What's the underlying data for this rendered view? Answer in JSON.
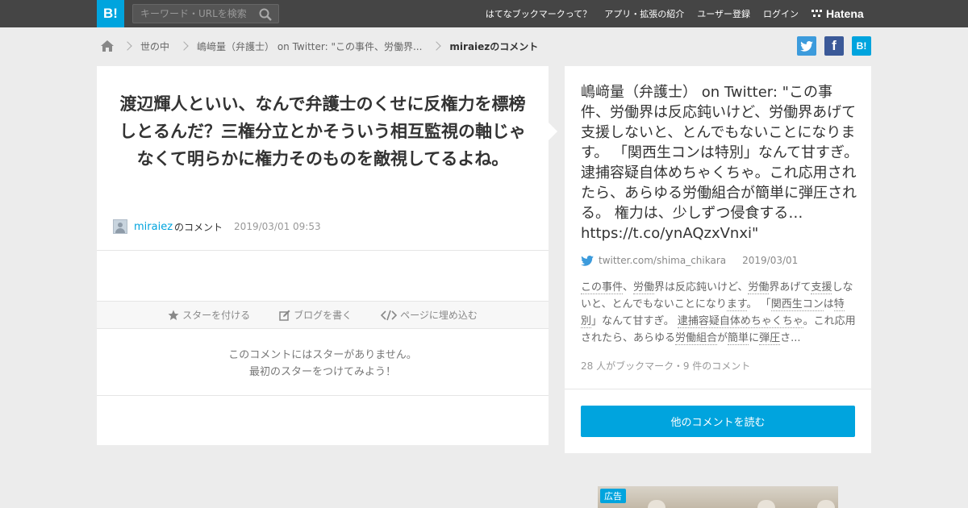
{
  "header": {
    "logo_text": "B!",
    "search_placeholder": "キーワード・URLを検索",
    "nav": [
      "はてなブックマークって？",
      "アプリ・拡張の紹介",
      "ユーザー登録",
      "ログイン"
    ],
    "hatena_label": "Hatena"
  },
  "breadcrumb": {
    "category": "世の中",
    "entry": "嶋﨑量（弁護士） on Twitter: \"この事件、労働界...",
    "current": "miraiezのコメント"
  },
  "share": {
    "hatena_label": "B!",
    "facebook_label": "f",
    "colors": {
      "twitter": "#3c9bdc",
      "facebook": "#3b5998",
      "hatena": "#00a4de"
    }
  },
  "comment": {
    "text": "渡辺輝人といい、なんで弁護士のくせに反権力を標榜しとるんだ？三権分立とかそういう相互監視の軸じゃなくて明らかに権力そのものを敵視してるよね。",
    "user": "miraiez",
    "user_suffix": "のコメント",
    "date": "2019/03/01 09:53"
  },
  "actions": {
    "star": "スターを付ける",
    "blog": "ブログを書く",
    "embed": "ページに埋め込む"
  },
  "stars_empty": {
    "line1": "このコメントにはスターがありません。",
    "line2": "最初のスターをつけてみよう！"
  },
  "entry": {
    "title": "嶋﨑量（弁護士） on Twitter: \"この事件、労働界は反応鈍いけど、労働界あげて支援しないと、とんでもないことになります。 「関西生コンは特別」なんて甘すぎ。 逮捕容疑自体めちゃくちゃ。これ応用されたら、あらゆる労働組合が簡単に弾圧される。 権力は、少しずつ侵食する… https://t.co/ynAQzxVnxi\"",
    "source": "twitter.com/shima_chikara",
    "date": "2019/03/01",
    "summary_parts": [
      {
        "t": "この事件",
        "u": true
      },
      {
        "t": "、",
        "u": false
      },
      {
        "t": "労働",
        "u": true
      },
      {
        "t": "界は反応鈍いけど、",
        "u": false
      },
      {
        "t": "労働",
        "u": true
      },
      {
        "t": "界あげて",
        "u": false
      },
      {
        "t": "支援",
        "u": true
      },
      {
        "t": "しないと、とんでもないことになり",
        "u": false
      },
      {
        "t": "ます",
        "u": true
      },
      {
        "t": "。 「",
        "u": false
      },
      {
        "t": "関西生コン",
        "u": true
      },
      {
        "t": "は",
        "u": false
      },
      {
        "t": "特別",
        "u": true
      },
      {
        "t": "」なんて甘すぎ。 ",
        "u": false
      },
      {
        "t": "逮捕容疑自体めちゃくちゃ",
        "u": true
      },
      {
        "t": "。これ応用されたら、あらゆる",
        "u": false
      },
      {
        "t": "労働組合",
        "u": true
      },
      {
        "t": "が",
        "u": false
      },
      {
        "t": "簡単",
        "u": true
      },
      {
        "t": "に",
        "u": false
      },
      {
        "t": "弾圧",
        "u": true
      },
      {
        "t": "さ...",
        "u": false
      }
    ],
    "counts": "28 人がブックマーク・9 件のコメント",
    "read_more": "他のコメントを読む"
  },
  "ad": {
    "badge": "広告"
  }
}
